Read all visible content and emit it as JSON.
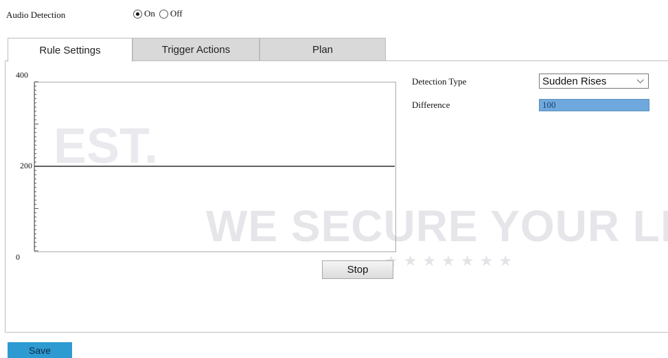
{
  "header": {
    "audio_detection_label": "Audio Detection",
    "on_label": "On",
    "off_label": "Off",
    "selected": "On"
  },
  "tabs": [
    {
      "label": "Rule Settings",
      "active": true
    },
    {
      "label": "Trigger Actions",
      "active": false
    },
    {
      "label": "Plan",
      "active": false
    }
  ],
  "chart_data": {
    "type": "line",
    "y_ticks": [
      "400",
      "200",
      "0"
    ],
    "ylim": [
      0,
      400
    ],
    "threshold": 200,
    "x": [],
    "series": []
  },
  "stop_button_label": "Stop",
  "detection": {
    "type_label": "Detection Type",
    "type_value": "Sudden Rises",
    "difference_label": "Difference",
    "difference_value": "100"
  },
  "save_button_label": "Save",
  "watermark": {
    "est": "EST.",
    "slogan": "WE SECURE YOUR LIF",
    "stars": "★★★★★★★"
  },
  "colors": {
    "save_button": "#2d9bd2",
    "difference_field": "#6fa8dc",
    "tab_inactive": "#d9d9d9"
  }
}
